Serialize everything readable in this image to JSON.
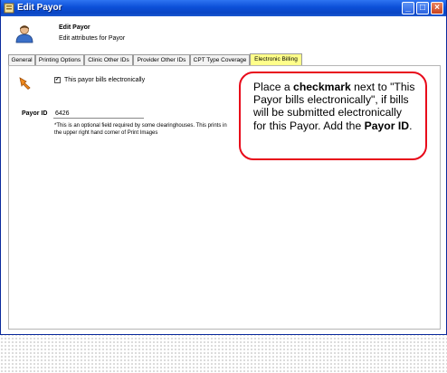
{
  "window": {
    "title": "Edit Payor",
    "controls": {
      "minimize": "_",
      "maximize": "□",
      "close": "×"
    }
  },
  "header": {
    "title": "Edit Payor",
    "subtitle": "Edit attributes for Payor",
    "icon": "user-icon"
  },
  "tabs": [
    {
      "label": "General"
    },
    {
      "label": "Printing Options"
    },
    {
      "label": "Clinic Other IDs"
    },
    {
      "label": "Provider Other IDs"
    },
    {
      "label": "CPT Type Coverage"
    },
    {
      "label": "Electronic Billing",
      "active": true
    }
  ],
  "electronic_billing": {
    "checkbox_label": "This payor bills electronically",
    "checkbox_checked": true,
    "checkmark": "✓",
    "payor_id_label": "Payor ID",
    "payor_id_value": "6426",
    "help_text": "*This is an optional field required by some clearinghouses.  This prints in the upper right hand corner of Print Images"
  },
  "callout": {
    "text1": "Place a ",
    "bold1": "checkmark",
    "text2": " next to \"This Payor bills electronically\", if bills will be submitted electronically for this Payor. Add the ",
    "bold2": "Payor ID",
    "text3": "."
  },
  "colors": {
    "titlebar": "#0c4fd7",
    "active_tab": "#ffff8a",
    "callout_border": "#e8091a"
  }
}
